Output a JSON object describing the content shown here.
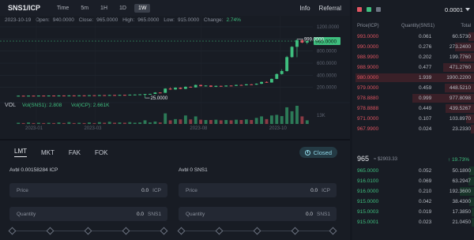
{
  "header": {
    "pair": "SNS1/ICP",
    "timeframes": [
      "Time",
      "5m",
      "1H",
      "1D",
      "1W"
    ],
    "active_timeframe": "1W",
    "links": [
      "Info",
      "Referral"
    ]
  },
  "chart_info": {
    "date": "2023-10-19",
    "open_label": "Open:",
    "open": "940.0000",
    "close_label": "Close:",
    "close": "965.0000",
    "high_label": "High:",
    "high": "965.0000",
    "low_label": "Low:",
    "low": "915.0000",
    "change_label": "Change:",
    "change": "2.74%",
    "vol_label": "VOL",
    "vol_sns1": "Vol(SNS1): 2.808",
    "vol_icp": "Vol(ICP): 2.661K",
    "current_price_tag": "965.0000",
    "high_marker": "999.0000",
    "low_marker": "25.0000"
  },
  "chart_data": {
    "type": "candlestick",
    "price_axis": [
      "1200.0000",
      "1000.0000",
      "800.0000",
      "600.0000",
      "400.0000",
      "200.0000"
    ],
    "price_ylim": [
      0,
      1200
    ],
    "volume_axis": [
      "13K"
    ],
    "x_ticks": [
      "2023-01",
      "2023-03",
      "2023-08",
      "2023-10"
    ],
    "candles": [
      {
        "o": 60,
        "c": 62,
        "h": 64,
        "l": 58,
        "v": 0.4
      },
      {
        "o": 62,
        "c": 61,
        "h": 63,
        "l": 60,
        "v": 0.3
      },
      {
        "o": 61,
        "c": 63,
        "h": 65,
        "l": 60,
        "v": 0.5
      },
      {
        "o": 63,
        "c": 62,
        "h": 64,
        "l": 61,
        "v": 0.3
      },
      {
        "o": 62,
        "c": 64,
        "h": 66,
        "l": 61,
        "v": 0.4
      },
      {
        "o": 64,
        "c": 63,
        "h": 65,
        "l": 62,
        "v": 0.3
      },
      {
        "o": 63,
        "c": 65,
        "h": 66,
        "l": 62,
        "v": 0.4
      },
      {
        "o": 65,
        "c": 64,
        "h": 66,
        "l": 63,
        "v": 0.3
      },
      {
        "o": 64,
        "c": 66,
        "h": 68,
        "l": 63,
        "v": 0.5
      },
      {
        "o": 66,
        "c": 65,
        "h": 67,
        "l": 64,
        "v": 0.3
      },
      {
        "o": 65,
        "c": 67,
        "h": 70,
        "l": 64,
        "v": 0.6
      },
      {
        "o": 67,
        "c": 66,
        "h": 68,
        "l": 65,
        "v": 0.3
      },
      {
        "o": 66,
        "c": 68,
        "h": 70,
        "l": 65,
        "v": 0.4
      },
      {
        "o": 68,
        "c": 67,
        "h": 69,
        "l": 66,
        "v": 0.3
      },
      {
        "o": 67,
        "c": 70,
        "h": 72,
        "l": 66,
        "v": 0.5
      },
      {
        "o": 70,
        "c": 69,
        "h": 71,
        "l": 68,
        "v": 0.3
      },
      {
        "o": 69,
        "c": 72,
        "h": 75,
        "l": 68,
        "v": 0.6
      },
      {
        "o": 72,
        "c": 71,
        "h": 73,
        "l": 70,
        "v": 0.4
      },
      {
        "o": 71,
        "c": 74,
        "h": 76,
        "l": 70,
        "v": 0.7
      },
      {
        "o": 74,
        "c": 73,
        "h": 75,
        "l": 72,
        "v": 0.4
      },
      {
        "o": 73,
        "c": 76,
        "h": 78,
        "l": 72,
        "v": 0.5
      },
      {
        "o": 76,
        "c": 75,
        "h": 78,
        "l": 74,
        "v": 0.4
      },
      {
        "o": 75,
        "c": 80,
        "h": 82,
        "l": 74,
        "v": 0.6
      },
      {
        "o": 80,
        "c": 82,
        "h": 84,
        "l": 79,
        "v": 0.4
      },
      {
        "o": 82,
        "c": 85,
        "h": 87,
        "l": 80,
        "v": 0.5
      },
      {
        "o": 85,
        "c": 90,
        "h": 92,
        "l": 25,
        "v": 1.2
      },
      {
        "o": 90,
        "c": 92,
        "h": 95,
        "l": 88,
        "v": 0.5
      },
      {
        "o": 92,
        "c": 115,
        "h": 120,
        "l": 90,
        "v": 0.8
      },
      {
        "o": 115,
        "c": 110,
        "h": 118,
        "l": 105,
        "v": 0.5
      },
      {
        "o": 110,
        "c": 180,
        "h": 185,
        "l": 108,
        "v": 3.5
      },
      {
        "o": 180,
        "c": 165,
        "h": 200,
        "l": 160,
        "v": 1.2
      },
      {
        "o": 165,
        "c": 195,
        "h": 200,
        "l": 160,
        "v": 1.6
      },
      {
        "o": 195,
        "c": 175,
        "h": 200,
        "l": 170,
        "v": 1.5
      },
      {
        "o": 175,
        "c": 210,
        "h": 215,
        "l": 172,
        "v": 2.8
      },
      {
        "o": 210,
        "c": 200,
        "h": 215,
        "l": 195,
        "v": 1.5
      },
      {
        "o": 200,
        "c": 240,
        "h": 245,
        "l": 198,
        "v": 2.5
      },
      {
        "o": 240,
        "c": 220,
        "h": 245,
        "l": 215,
        "v": 1.4
      },
      {
        "o": 220,
        "c": 230,
        "h": 235,
        "l": 215,
        "v": 1.3
      },
      {
        "o": 230,
        "c": 210,
        "h": 235,
        "l": 205,
        "v": 1.3
      },
      {
        "o": 210,
        "c": 225,
        "h": 230,
        "l": 205,
        "v": 1.4
      },
      {
        "o": 225,
        "c": 215,
        "h": 228,
        "l": 210,
        "v": 1.2
      },
      {
        "o": 215,
        "c": 230,
        "h": 232,
        "l": 212,
        "v": 1.3
      },
      {
        "o": 230,
        "c": 225,
        "h": 233,
        "l": 220,
        "v": 1.2
      },
      {
        "o": 225,
        "c": 240,
        "h": 245,
        "l": 222,
        "v": 1.4
      },
      {
        "o": 240,
        "c": 235,
        "h": 245,
        "l": 230,
        "v": 1.3
      },
      {
        "o": 235,
        "c": 250,
        "h": 255,
        "l": 232,
        "v": 1.5
      },
      {
        "o": 250,
        "c": 245,
        "h": 255,
        "l": 240,
        "v": 1.3
      },
      {
        "o": 245,
        "c": 260,
        "h": 265,
        "l": 242,
        "v": 2.0
      },
      {
        "o": 260,
        "c": 290,
        "h": 295,
        "l": 255,
        "v": 2.5
      },
      {
        "o": 290,
        "c": 280,
        "h": 300,
        "l": 275,
        "v": 1.6
      },
      {
        "o": 280,
        "c": 340,
        "h": 345,
        "l": 278,
        "v": 2.8
      },
      {
        "o": 340,
        "c": 420,
        "h": 430,
        "l": 335,
        "v": 3.0
      },
      {
        "o": 420,
        "c": 470,
        "h": 500,
        "l": 410,
        "v": 2.6
      },
      {
        "o": 470,
        "c": 700,
        "h": 720,
        "l": 460,
        "v": 5.5
      },
      {
        "o": 700,
        "c": 870,
        "h": 880,
        "l": 690,
        "v": 4.2
      },
      {
        "o": 870,
        "c": 980,
        "h": 999,
        "l": 700,
        "v": 6.0
      },
      {
        "o": 980,
        "c": 940,
        "h": 990,
        "l": 930,
        "v": 2.5
      },
      {
        "o": 940,
        "c": 965,
        "h": 965,
        "l": 915,
        "v": 1.2
      }
    ]
  },
  "order_form": {
    "tabs": [
      "LMT",
      "MKT",
      "FAK",
      "FOK"
    ],
    "active_tab": "LMT",
    "status_button": "Closed",
    "buy": {
      "avbl": "Avbl 0.00158284 ICP",
      "price_label": "Price",
      "price_value": "0.0",
      "price_unit": "ICP",
      "qty_label": "Quantity",
      "qty_value": "0.0",
      "qty_unit": "SNS1"
    },
    "sell": {
      "avbl": "Avbl 0 SNS1",
      "price_label": "Price",
      "price_value": "0.0",
      "price_unit": "ICP",
      "qty_label": "Quantity",
      "qty_value": "0.0",
      "qty_unit": "SNS1"
    }
  },
  "orderbook": {
    "precision": "0.0001",
    "headers": [
      "Price(ICP)",
      "Quantity(SNS1)",
      "Total"
    ],
    "asks": [
      {
        "price": "993.0000",
        "qty": "0.061",
        "total": "60.5730",
        "depth": 0.05
      },
      {
        "price": "990.0000",
        "qty": "0.276",
        "total": "273.2400",
        "depth": 0.16
      },
      {
        "price": "988.9900",
        "qty": "0.202",
        "total": "199.7760",
        "depth": 0.12
      },
      {
        "price": "988.9000",
        "qty": "0.477",
        "total": "471.2760",
        "depth": 0.26
      },
      {
        "price": "980.0000",
        "qty": "1.939",
        "total": "1900.2200",
        "depth": 1.0
      },
      {
        "price": "979.0000",
        "qty": "0.459",
        "total": "448.5210",
        "depth": 0.25
      },
      {
        "price": "978.8880",
        "qty": "0.999",
        "total": "977.8098",
        "depth": 0.52
      },
      {
        "price": "978.8888",
        "qty": "0.449",
        "total": "439.5267",
        "depth": 0.24
      },
      {
        "price": "971.0000",
        "qty": "0.107",
        "total": "103.8970",
        "depth": 0.07
      },
      {
        "price": "967.9900",
        "qty": "0.024",
        "total": "23.2330",
        "depth": 0.03
      }
    ],
    "last_price": "965",
    "last_usd": "≈ $2903.33",
    "change": "↑ 19.73%",
    "bids": [
      {
        "price": "965.0000",
        "qty": "0.052",
        "total": "50.1800",
        "depth": 0.04
      },
      {
        "price": "916.0100",
        "qty": "0.069",
        "total": "63.2947",
        "depth": 0.05
      },
      {
        "price": "916.0000",
        "qty": "0.210",
        "total": "192.3600",
        "depth": 0.12
      },
      {
        "price": "915.0000",
        "qty": "0.042",
        "total": "38.4300",
        "depth": 0.04
      },
      {
        "price": "915.0003",
        "qty": "0.019",
        "total": "17.3850",
        "depth": 0.02
      },
      {
        "price": "915.0001",
        "qty": "0.023",
        "total": "21.0450",
        "depth": 0.02
      }
    ]
  }
}
